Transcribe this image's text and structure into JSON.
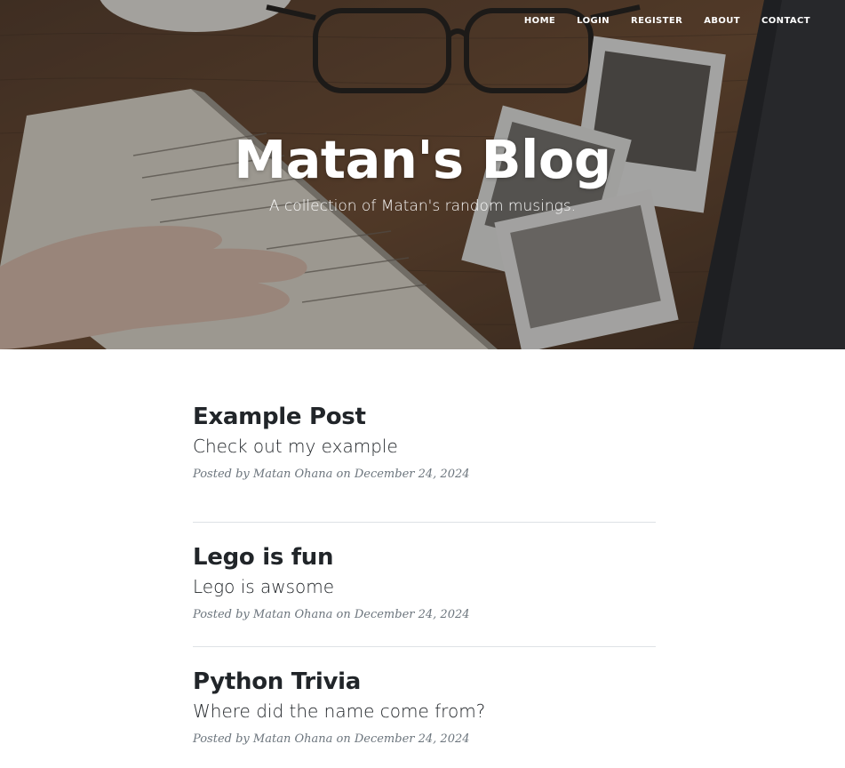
{
  "nav": {
    "items": [
      {
        "label": "HOME"
      },
      {
        "label": "LOGIN"
      },
      {
        "label": "REGISTER"
      },
      {
        "label": "ABOUT"
      },
      {
        "label": "CONTACT"
      }
    ]
  },
  "header": {
    "title": "Matan's Blog",
    "subtitle": "A collection of Matan's random musings."
  },
  "posts": [
    {
      "title": "Example Post",
      "subtitle": "Check out my example",
      "meta_prefix": "Posted by",
      "author": "Matan Ohana",
      "meta_on": "on",
      "date": "December 24, 2024"
    },
    {
      "title": "Lego is fun",
      "subtitle": "Lego is awsome",
      "meta_prefix": "Posted by",
      "author": "Matan Ohana",
      "meta_on": "on",
      "date": "December 24, 2024"
    },
    {
      "title": "Python Trivia",
      "subtitle": "Where did the name come from?",
      "meta_prefix": "Posted by",
      "author": "Matan Ohana",
      "meta_on": "on",
      "date": "December 24, 2024"
    }
  ],
  "colors": {
    "text": "#212529",
    "meta": "#6c757d",
    "divider": "#dee2e6",
    "wood": "#5a3b22"
  },
  "header_image": "desk-photo-with-notebook-glasses-polaroids"
}
